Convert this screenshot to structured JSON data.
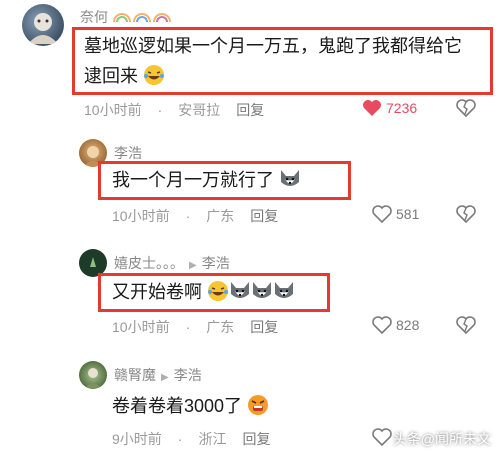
{
  "comments": [
    {
      "username": "奈何",
      "text_line1": "墓地巡逻如果一个月一万五，鬼跑了我都得给它",
      "text_line2": "逮回来",
      "time": "10小时前",
      "location": "安哥拉",
      "reply_label": "回复",
      "likes": "7236",
      "liked": true
    },
    {
      "username": "李浩",
      "text": "我一个月一万就行了",
      "time": "10小时前",
      "location": "广东",
      "reply_label": "回复",
      "likes": "581",
      "liked": false
    },
    {
      "username": "嬉皮士。。。",
      "reply_to": "李浩",
      "text": "又开始卷啊",
      "time": "10小时前",
      "location": "广东",
      "reply_label": "回复",
      "likes": "828",
      "liked": false
    },
    {
      "username": "赣腎魔",
      "reply_to": "李浩",
      "text": "卷着卷着3000了",
      "time": "9小时前",
      "location": "浙江",
      "reply_label": "回复"
    }
  ],
  "watermark": "头条@闻所未文",
  "colors": {
    "highlight_border": "#e53a2e",
    "liked_heart": "#e84a5f",
    "meta_gray": "#9a9a9a"
  },
  "icons": [
    "heart-icon",
    "broken-heart-icon",
    "laugh-cry-emoji",
    "husky-emoji",
    "angry-emoji"
  ]
}
